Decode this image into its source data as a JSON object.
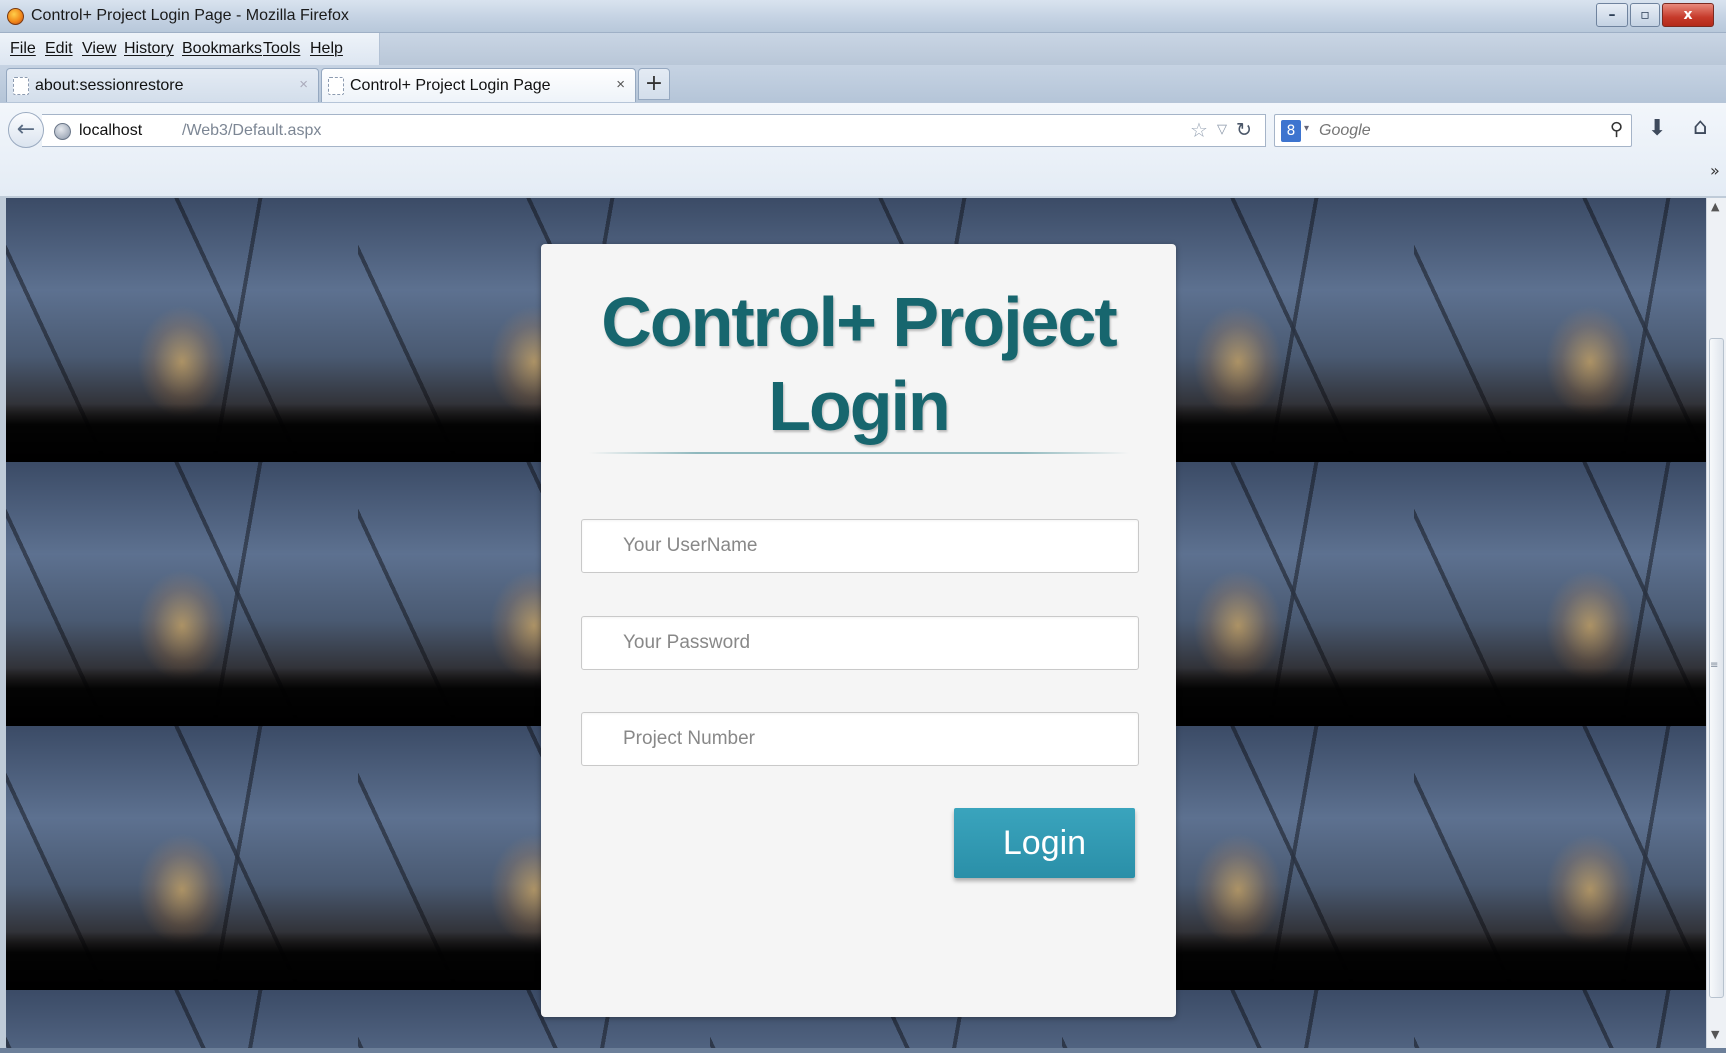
{
  "window": {
    "title": "Control+ Project Login Page - Mozilla Firefox",
    "minimize": "–",
    "maximize": "▫",
    "close": "x"
  },
  "menu": {
    "items": [
      "File",
      "Edit",
      "View",
      "History",
      "Bookmarks",
      "Tools",
      "Help"
    ]
  },
  "tabs": [
    {
      "label": "about:sessionrestore",
      "close": "×"
    },
    {
      "label": "Control+ Project Login Page",
      "close": "×"
    }
  ],
  "new_tab_label": "+",
  "address_bar": {
    "host": "localhost",
    "path": "/Web3/Default.aspx"
  },
  "search_bar": {
    "engine_badge": "8",
    "placeholder": "Google"
  },
  "login": {
    "title": "Control+ Project Login",
    "username_placeholder": "Your UserName",
    "password_placeholder": "Your Password",
    "project_placeholder": "Project Number",
    "button_label": "Login"
  },
  "colors": {
    "title_teal": "#17666e",
    "button_blue": "#2a8fa8"
  }
}
